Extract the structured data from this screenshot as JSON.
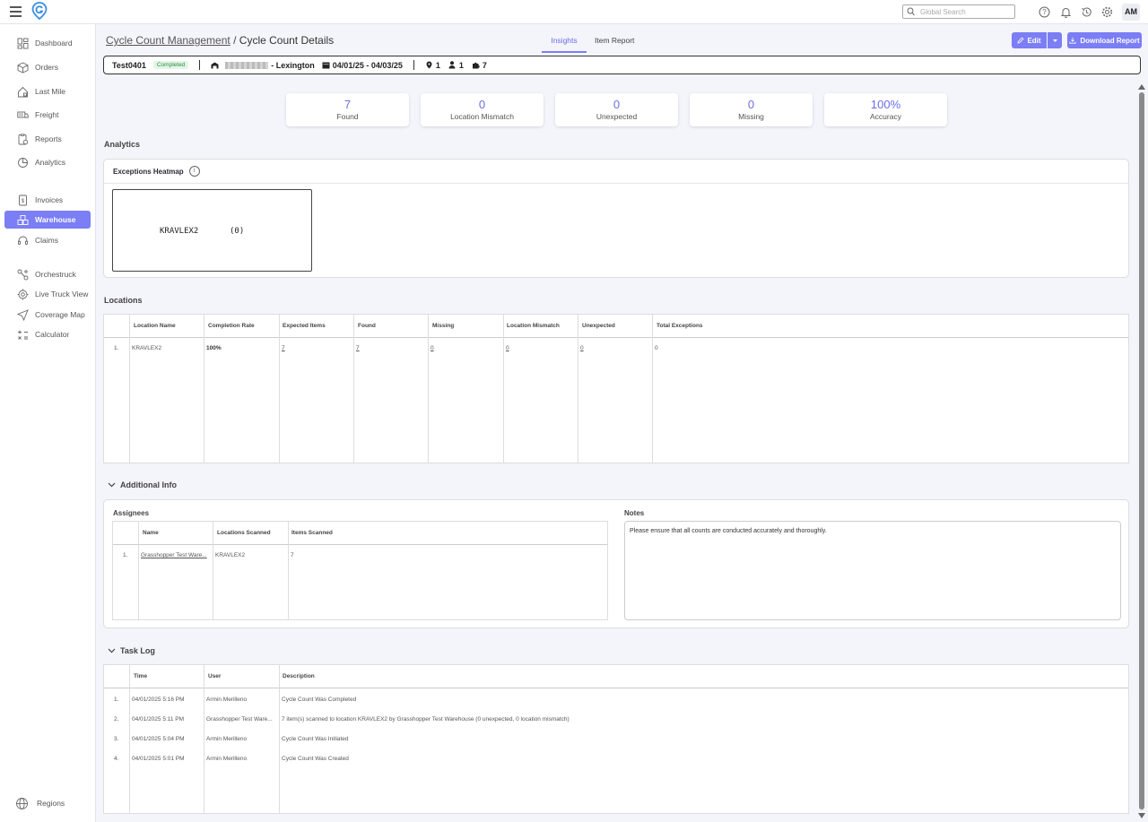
{
  "topbar": {
    "search_placeholder": "Global Search",
    "avatar_initials": "AM"
  },
  "sidebar": {
    "items": [
      {
        "label": "Dashboard",
        "icon": "dashboard-icon"
      },
      {
        "label": "Orders",
        "icon": "box-icon"
      },
      {
        "label": "Last Mile",
        "icon": "house-icon"
      },
      {
        "label": "Freight",
        "icon": "truck-icon"
      },
      {
        "label": "Reports",
        "icon": "report-icon"
      },
      {
        "label": "Analytics",
        "icon": "analytics-icon"
      },
      {
        "label": "Invoices",
        "icon": "invoice-icon"
      },
      {
        "label": "Warehouse",
        "icon": "warehouse-icon",
        "active": true
      },
      {
        "label": "Claims",
        "icon": "headset-icon"
      },
      {
        "label": "Orchestruck",
        "icon": "orchestruck-icon"
      },
      {
        "label": "Live Truck View",
        "icon": "target-icon"
      },
      {
        "label": "Coverage Map",
        "icon": "send-icon"
      },
      {
        "label": "Calculator",
        "icon": "calculator-icon"
      }
    ],
    "footer_label": "Regions"
  },
  "header": {
    "breadcrumb_parent": "Cycle Count Management",
    "breadcrumb_sep": "/",
    "breadcrumb_current": "Cycle Count Details",
    "tabs": [
      {
        "label": "Insights"
      },
      {
        "label": "Item Report"
      }
    ],
    "edit_label": "Edit",
    "download_label": "Download Report"
  },
  "summary": {
    "name": "Test0401",
    "status": "Completed",
    "location_suffix": "- Lexington",
    "date_range": "04/01/25 - 04/03/25",
    "locations_count": "1",
    "users_count": "1",
    "items_count": "7"
  },
  "stats": [
    {
      "value": "7",
      "label": "Found"
    },
    {
      "value": "0",
      "label": "Location Mismatch"
    },
    {
      "value": "0",
      "label": "Unexpected"
    },
    {
      "value": "0",
      "label": "Missing"
    },
    {
      "value": "100%",
      "label": "Accuracy"
    }
  ],
  "analytics": {
    "title": "Analytics",
    "heatmap_title": "Exceptions Heatmap",
    "info": "i",
    "cell_label": "KRAVLEX2",
    "cell_count": "(0)"
  },
  "locations": {
    "title": "Locations",
    "headers": [
      "Location Name",
      "Completion Rate",
      "Expected Items",
      "Found",
      "Missing",
      "Location Mismatch",
      "Unexpected",
      "Total Exceptions"
    ],
    "rows": [
      {
        "index": "1.",
        "name": "KRAVLEX2",
        "completion": "100%",
        "expected": "7",
        "found": "7",
        "missing": "0",
        "mismatch": "0",
        "unexpected": "0",
        "total": "0"
      }
    ]
  },
  "additional": {
    "title": "Additional Info",
    "assignees_title": "Assignees",
    "assignee_headers": [
      "Name",
      "Locations Scanned",
      "Items Scanned"
    ],
    "assignees": [
      {
        "index": "1.",
        "name": "Grasshopper Test Ware...",
        "locations": "KRAVLEX2",
        "items": "7"
      }
    ],
    "notes_title": "Notes",
    "notes": "Please ensure that all counts are conducted accurately and thoroughly."
  },
  "tasklog": {
    "title": "Task Log",
    "headers": [
      "Time",
      "User",
      "Description"
    ],
    "rows": [
      {
        "index": "1.",
        "time": "04/01/2025 5:16 PM",
        "user": "Armin Merilleno",
        "desc": "Cycle Count Was Completed"
      },
      {
        "index": "2.",
        "time": "04/01/2025 5:11 PM",
        "user": "Grasshopper Test Ware...",
        "desc": "7 item(s) scanned to location KRAVLEX2 by Grasshopper Test Warehouse (0 unexpected, 0 location mismatch)"
      },
      {
        "index": "3.",
        "time": "04/01/2025 5:04 PM",
        "user": "Armin Merilleno",
        "desc": "Cycle Count Was Initiated"
      },
      {
        "index": "4.",
        "time": "04/01/2025 5:01 PM",
        "user": "Armin Merilleno",
        "desc": "Cycle Count Was Created"
      }
    ]
  },
  "colors": {
    "accent": "#7b7ef4",
    "accent_text": "#6a6de8",
    "status_green": "#2e8b46"
  }
}
